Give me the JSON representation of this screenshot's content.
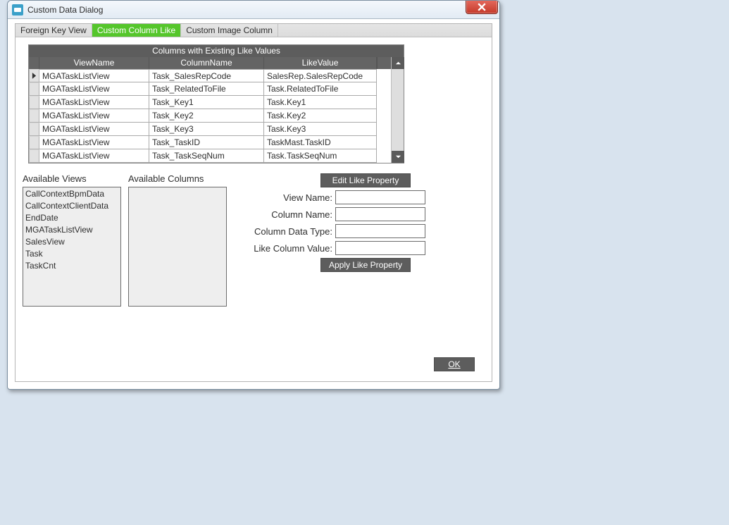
{
  "window": {
    "title": "Custom Data Dialog"
  },
  "tabs": {
    "foreign_key": "Foreign Key View",
    "custom_like": "Custom Column Like",
    "custom_image": "Custom Image Column"
  },
  "grid": {
    "title": "Columns with Existing Like Values",
    "headers": {
      "view": "ViewName",
      "col": "ColumnName",
      "like": "LikeValue"
    },
    "rows": [
      {
        "view": "MGATaskListView",
        "col": "Task_SalesRepCode",
        "like": "SalesRep.SalesRepCode",
        "current": true
      },
      {
        "view": "MGATaskListView",
        "col": "Task_RelatedToFile",
        "like": "Task.RelatedToFile"
      },
      {
        "view": "MGATaskListView",
        "col": "Task_Key1",
        "like": "Task.Key1"
      },
      {
        "view": "MGATaskListView",
        "col": "Task_Key2",
        "like": "Task.Key2"
      },
      {
        "view": "MGATaskListView",
        "col": "Task_Key3",
        "like": "Task.Key3"
      },
      {
        "view": "MGATaskListView",
        "col": "Task_TaskID",
        "like": "TaskMast.TaskID"
      },
      {
        "view": "MGATaskListView",
        "col": "Task_TaskSeqNum",
        "like": "Task.TaskSeqNum"
      }
    ]
  },
  "labels": {
    "available_views": "Available Views",
    "available_columns": "Available Columns",
    "edit_btn": "Edit Like Property",
    "apply_btn": "Apply Like Property",
    "view_name": "View Name:",
    "column_name": "Column Name:",
    "column_type": "Column Data Type:",
    "like_value": "Like Column Value:",
    "ok": "OK"
  },
  "views_list": [
    "CallContextBpmData",
    "CallContextClientData",
    "EndDate",
    "MGATaskListView",
    "SalesView",
    "Task",
    "TaskCnt"
  ],
  "form": {
    "view_name": "",
    "column_name": "",
    "column_type": "",
    "like_value": ""
  }
}
